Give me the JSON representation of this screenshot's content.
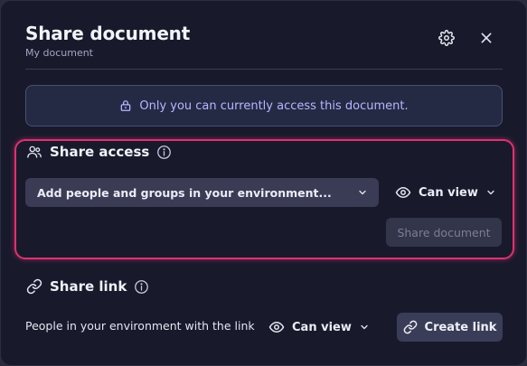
{
  "dialog": {
    "title": "Share document",
    "subtitle": "My document",
    "settings_icon": "gear-icon",
    "close_icon": "close-icon"
  },
  "notice": {
    "icon": "lock-icon",
    "text": "Only you can currently access this document."
  },
  "share_access": {
    "title": "Share access",
    "info_icon": "info-icon",
    "people_select_value": "Add people and groups in your environment...",
    "permission_label": "Can view",
    "share_button_label": "Share document",
    "share_button_enabled": false,
    "highlight_color": "#e0316f"
  },
  "share_link": {
    "title": "Share link",
    "info_icon": "info-icon",
    "description": "People in your environment with the link",
    "permission_label": "Can view",
    "create_button_label": "Create link"
  },
  "colors": {
    "background": "#181a2c",
    "notice_text": "#b8b6ff",
    "accent_highlight": "#e0316f"
  }
}
